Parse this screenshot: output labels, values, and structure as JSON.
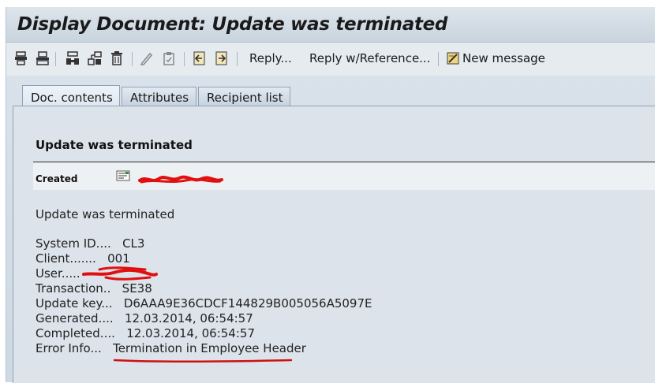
{
  "window": {
    "title": "Display Document: Update was terminated"
  },
  "toolbar": {
    "icons": [
      "print-icon",
      "print-preview-icon",
      "find-icon",
      "hierarchy-icon",
      "delete-icon",
      "edit-pencil-icon",
      "clipboard-icon",
      "previous-icon",
      "next-icon"
    ],
    "reply_label": "Reply...",
    "reply_ref_label": "Reply w/Reference...",
    "new_message_label": "New message"
  },
  "tabs": [
    {
      "label": "Doc. contents",
      "active": true
    },
    {
      "label": "Attributes",
      "active": false
    },
    {
      "label": "Recipient list",
      "active": false
    }
  ],
  "document": {
    "heading": "Update was terminated",
    "created_label": "Created",
    "summary": "Update was terminated",
    "fields": [
      {
        "label": "System ID....",
        "value": "CL3"
      },
      {
        "label": "Client.......",
        "value": "001"
      },
      {
        "label": "User.....",
        "value": ""
      },
      {
        "label": "Transaction..",
        "value": "SE38"
      },
      {
        "label": "Update key...",
        "value": "D6AAA9E36CDCF144829B005056A5097E"
      },
      {
        "label": "Generated....",
        "value": "12.03.2014, 06:54:57"
      },
      {
        "label": "Completed....",
        "value": "12.03.2014, 06:54:57"
      },
      {
        "label": "Error Info...",
        "value": "Termination in Employee Header"
      }
    ]
  },
  "colors": {
    "redaction": "#e01010",
    "underline": "#d01010",
    "title_bar": "#c9d4de"
  }
}
